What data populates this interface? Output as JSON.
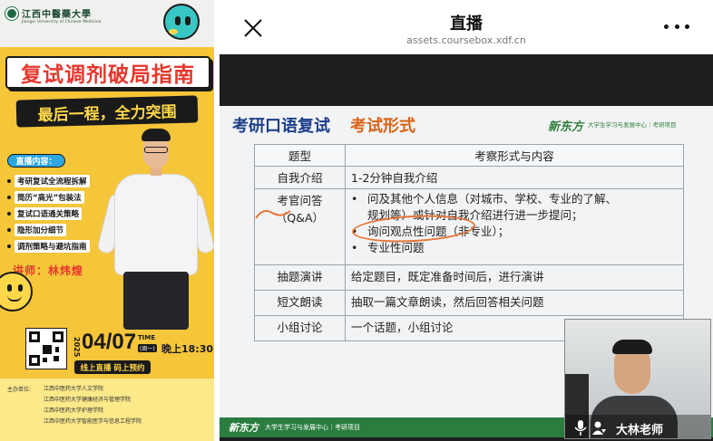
{
  "poster": {
    "university_name": "江西中醫藥大學",
    "university_en": "Jiangxi University of Chinese Medicine",
    "title": "复试调剂破局指南",
    "subtitle": "最后一程，全力突围",
    "content_tag": "直播内容：",
    "content_items": [
      "考研复试全流程拆解",
      "简历“高光”包装法",
      "复试口语通关策略",
      "隐形加分细节",
      "调剂策略与避坑指南"
    ],
    "lecturer": "讲师：林炜煌",
    "date_year": "2025",
    "date": "04/07",
    "time_label": "TIME",
    "weekday": "(周一)",
    "clock": "晚上18:30",
    "live_strip": "线上直播 码上预约",
    "organizer_label": "主办单位:",
    "organizers": [
      "江西中医药大学人文学院",
      "江西中医药大学健康经济与管理学院",
      "江西中医药大学护理学院",
      "江西中医药大学智能医学与信息工程学院"
    ]
  },
  "browser": {
    "title": "直播",
    "url": "assets.coursebox.xdf.cn",
    "close_icon": "close-icon",
    "more_icon": "more-dots-icon"
  },
  "slide": {
    "title_part1": "考研口语复试",
    "title_part2": "考试形式",
    "brand": "新东方",
    "brand_sub": "大学生学习与发展中心｜考研项目",
    "headers": [
      "题型",
      "考察形式与内容"
    ],
    "rows": [
      {
        "type": "自我介绍",
        "content": "1-2分钟自我介绍"
      },
      {
        "type": "考官问答（Q&A）",
        "bullets": [
          "问及其他个人信息（对城市、学校、专业的了解、",
          "询问观点性问题（非专业）；",
          "专业性问题"
        ],
        "bullet1_cont": "规划等）或针对自我介绍进行进一步提问；"
      },
      {
        "type": "抽题演讲",
        "content": "给定题目，既定准备时间后，进行演讲"
      },
      {
        "type": "短文朗读",
        "content": "抽取一篇文章朗读，然后回答相关问题"
      },
      {
        "type": "小组讨论",
        "content": "一个话题，小组讨论"
      }
    ],
    "footer_brand": "新东方",
    "footer_text": "大学生学习与发展中心｜考研项目"
  },
  "camera": {
    "name": "大林老师",
    "mic_icon": "microphone-icon",
    "person_icon": "participants-icon"
  },
  "colors": {
    "poster_bg": "#f5c53a",
    "title_red": "#e6372d",
    "slide_blue": "#1c3f8a",
    "slide_orange": "#d96316",
    "brand_green": "#2a7d3f"
  }
}
